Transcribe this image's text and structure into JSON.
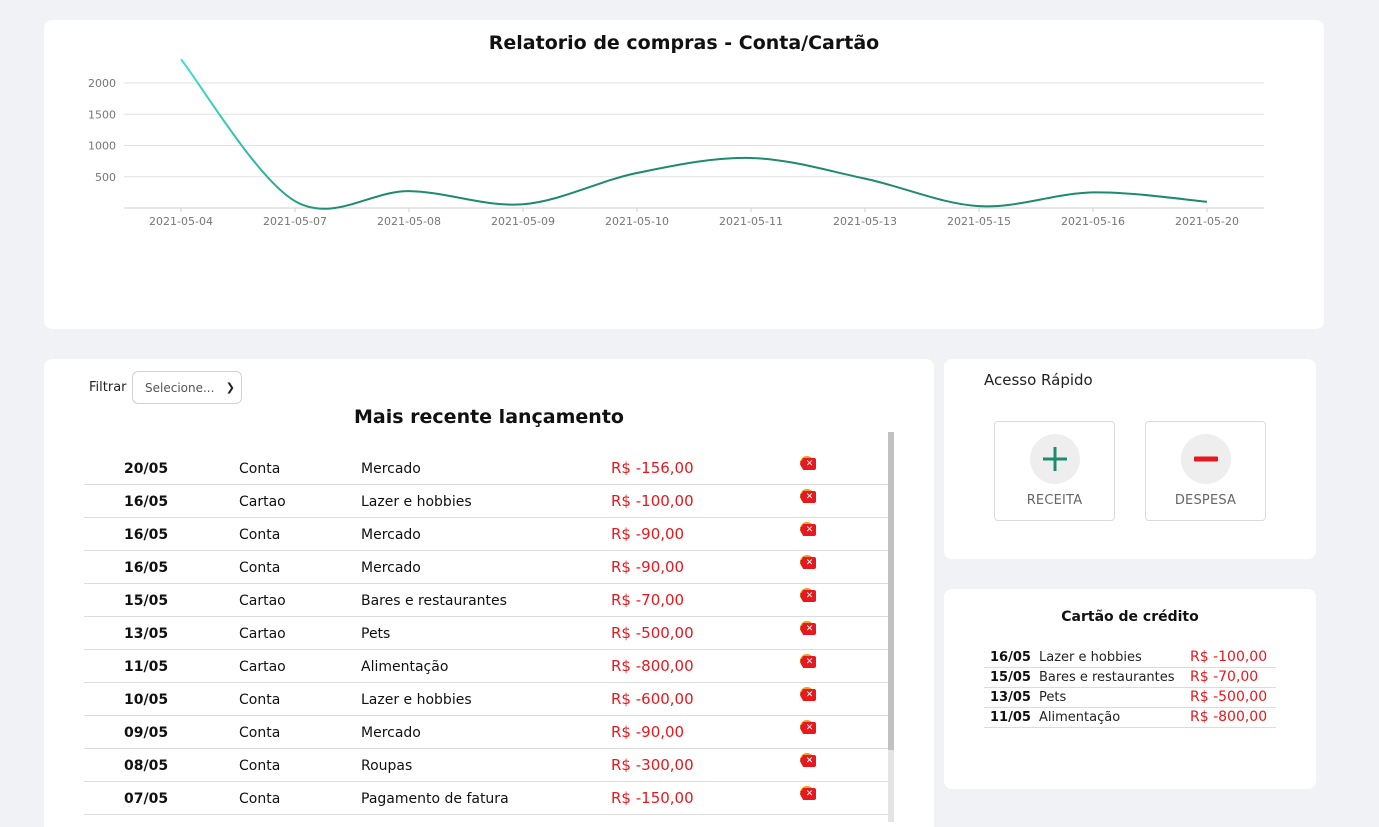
{
  "chart_data": {
    "type": "line",
    "title": "Relatorio de compras - Conta/Cartão",
    "x": [
      "2021-05-04",
      "2021-05-07",
      "2021-05-08",
      "2021-05-09",
      "2021-05-10",
      "2021-05-11",
      "2021-05-13",
      "2021-05-15",
      "2021-05-16",
      "2021-05-20"
    ],
    "values": [
      2380,
      110,
      270,
      60,
      560,
      800,
      470,
      30,
      250,
      100
    ],
    "yticks": [
      500,
      1000,
      1500,
      2000
    ],
    "ylim": [
      0,
      2400
    ],
    "grid": true,
    "colors": {
      "line_start": "#40e0d0",
      "line_end": "#1e8a6e"
    }
  },
  "transactions": {
    "filter_label": "Filtrar",
    "filter_value": "Selecione...",
    "title": "Mais recente lançamento",
    "action_separator": "-",
    "rows": [
      {
        "date": "20/05",
        "type": "Conta",
        "desc": "Mercado",
        "value": "R$ -156,00"
      },
      {
        "date": "16/05",
        "type": "Cartao",
        "desc": "Lazer e hobbies",
        "value": "R$ -100,00"
      },
      {
        "date": "16/05",
        "type": "Conta",
        "desc": "Mercado",
        "value": "R$ -90,00"
      },
      {
        "date": "16/05",
        "type": "Conta",
        "desc": "Mercado",
        "value": "R$ -90,00"
      },
      {
        "date": "15/05",
        "type": "Cartao",
        "desc": "Bares e restaurantes",
        "value": "R$ -70,00"
      },
      {
        "date": "13/05",
        "type": "Cartao",
        "desc": "Pets",
        "value": "R$ -500,00"
      },
      {
        "date": "11/05",
        "type": "Cartao",
        "desc": "Alimentação",
        "value": "R$ -800,00"
      },
      {
        "date": "10/05",
        "type": "Conta",
        "desc": "Lazer e hobbies",
        "value": "R$ -600,00"
      },
      {
        "date": "09/05",
        "type": "Conta",
        "desc": "Mercado",
        "value": "R$ -90,00"
      },
      {
        "date": "08/05",
        "type": "Conta",
        "desc": "Roupas",
        "value": "R$ -300,00"
      },
      {
        "date": "07/05",
        "type": "Conta",
        "desc": "Pagamento de fatura",
        "value": "R$ -150,00"
      }
    ]
  },
  "quick_access": {
    "title": "Acesso Rápido",
    "receita_label": "RECEITA",
    "despesa_label": "DESPESA",
    "icons": {
      "receita": "plus-icon",
      "despesa": "minus-icon"
    },
    "colors": {
      "receita": "#1e8a6e",
      "despesa": "#e5191e"
    }
  },
  "credit_card": {
    "title": "Cartão de crédito",
    "rows": [
      {
        "date": "16/05",
        "desc": "Lazer e hobbies",
        "value": "R$ -100,00"
      },
      {
        "date": "15/05",
        "desc": "Bares e restaurantes",
        "value": "R$ -70,00"
      },
      {
        "date": "13/05",
        "desc": "Pets",
        "value": "R$ -500,00"
      },
      {
        "date": "11/05",
        "desc": "Alimentação",
        "value": "R$ -800,00"
      }
    ]
  }
}
